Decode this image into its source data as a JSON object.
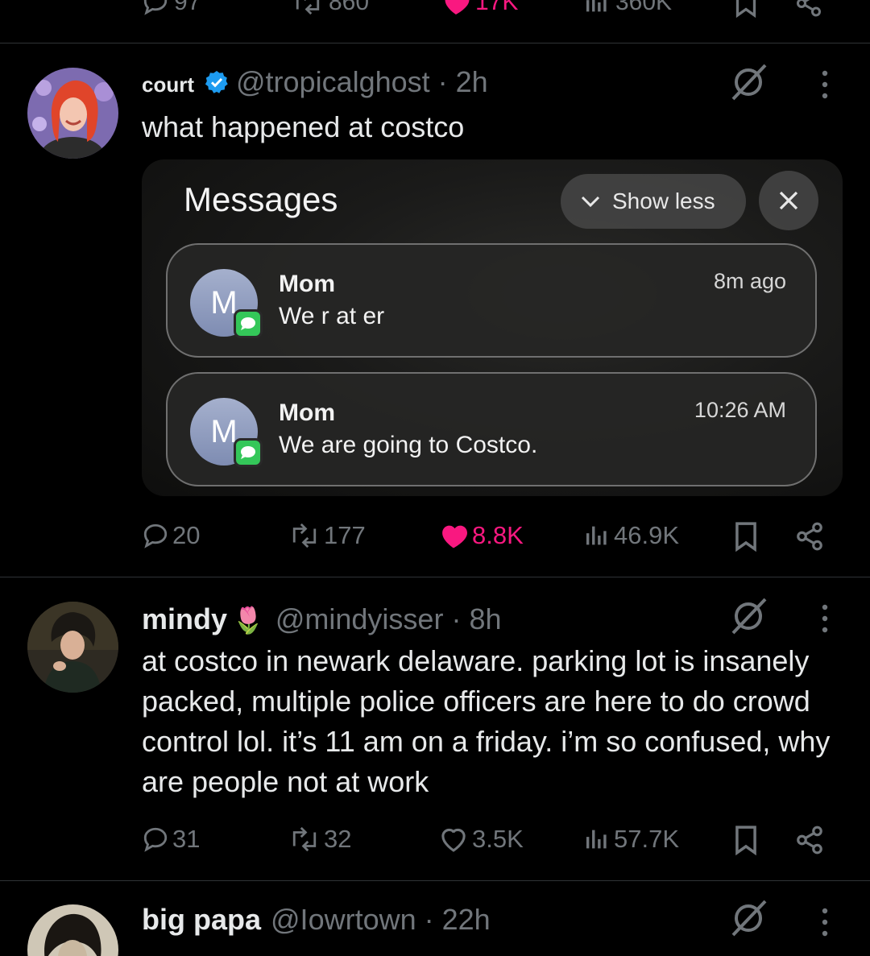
{
  "top_actions": {
    "replies": "97",
    "reposts": "860",
    "likes": "17K",
    "views": "360K"
  },
  "tweets": [
    {
      "name": "court",
      "verified": true,
      "handle": "@tropicalghost",
      "time": "· 2h",
      "text": "what happened at costco",
      "media": {
        "title": "Messages",
        "show_less": "Show less",
        "notifications": [
          {
            "avatar_letter": "M",
            "sender": "Mom",
            "body": "We r at er",
            "time": "8m ago"
          },
          {
            "avatar_letter": "M",
            "sender": "Mom",
            "body": "We are going to Costco.",
            "time": "10:26 AM"
          }
        ]
      },
      "stats": {
        "replies": "20",
        "reposts": "177",
        "likes": "8.8K",
        "views": "46.9K",
        "liked": true
      }
    },
    {
      "name": "mindy",
      "emoji": "🌷",
      "handle": "@mindyisser",
      "time": "· 8h",
      "text": "at costco in newark delaware. parking lot is insanely packed, multiple police officers are here to do crowd control lol. it’s 11 am on a friday. i’m so confused, why are people not at work",
      "stats": {
        "replies": "31",
        "reposts": "32",
        "likes": "3.5K",
        "views": "57.7K",
        "liked": false
      }
    },
    {
      "name": "big papa",
      "handle": "@Iowrtown",
      "time": "· 22h"
    }
  ],
  "colors": {
    "like_pink": "#f91880",
    "verified_blue": "#1d9bf0",
    "muted": "#71767b",
    "imessage_green": "#34c759"
  }
}
